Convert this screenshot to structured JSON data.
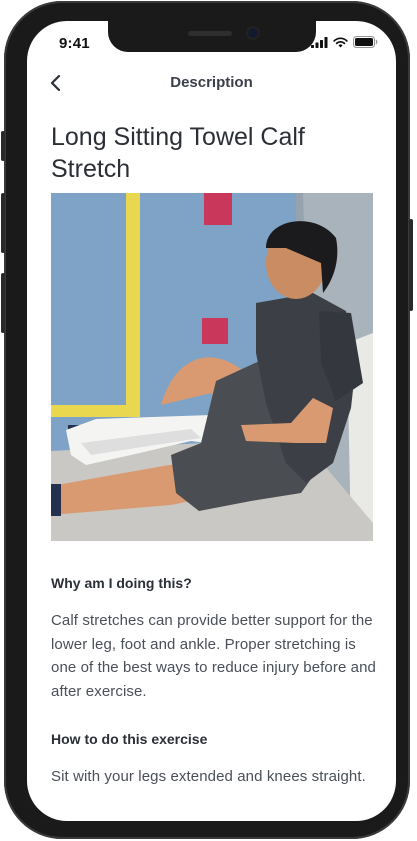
{
  "status_bar": {
    "time": "9:41"
  },
  "nav": {
    "title": "Description"
  },
  "exercise": {
    "title": "Long Sitting Towel Calf Stretch",
    "why_heading": "Why am I doing this?",
    "why_text": "Calf stretches can provide better support for the lower leg, foot and ankle. Proper stretching is one of the best ways to reduce injury before and after exercise.",
    "how_heading": "How to do this exercise",
    "how_text": "Sit with your legs extended and knees straight."
  },
  "colors": {
    "wall": "#7fa3c6",
    "tape_yellow": "#e9d84f",
    "tape_red": "#c9385a",
    "floor": "#c9c8c4",
    "text_dark": "#2b2f36"
  }
}
